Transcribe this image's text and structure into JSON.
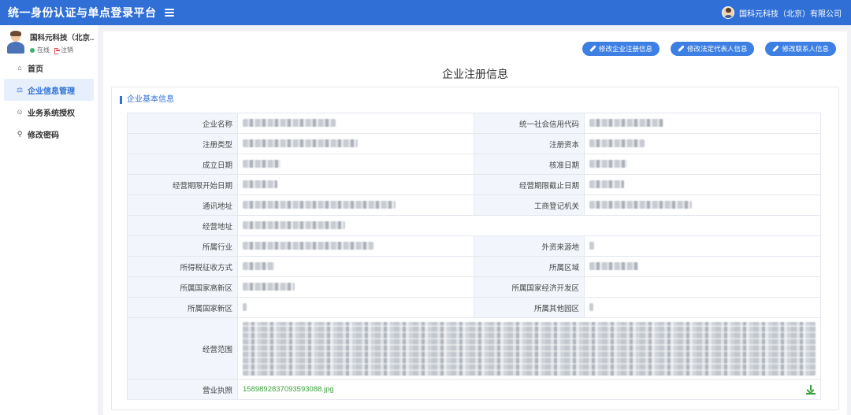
{
  "header": {
    "title": "统一身份认证与单点登录平台",
    "company": "国科元科技（北京）有限公司"
  },
  "sidebar": {
    "profile": {
      "name": "国科元科技（北京...",
      "status_online": "在线",
      "logout": "注销"
    },
    "items": [
      {
        "label": "首页",
        "icon": "home-icon"
      },
      {
        "label": "企业信息管理",
        "icon": "bank-icon"
      },
      {
        "label": "业务系统授权",
        "icon": "users-icon"
      },
      {
        "label": "修改密码",
        "icon": "key-icon"
      }
    ]
  },
  "actions": {
    "edit_registration": "修改企业注册信息",
    "edit_legal_rep": "修改法定代表人信息",
    "edit_contact": "修改联系人信息"
  },
  "page_title": "企业注册信息",
  "section_title": "企业基本信息",
  "fields": {
    "company_name": "企业名称",
    "credit_code": "统一社会信用代码",
    "reg_type": "注册类型",
    "reg_capital": "注册资本",
    "est_date": "成立日期",
    "approval_date": "核准日期",
    "op_start": "经营期限开始日期",
    "op_end": "经营期限截止日期",
    "mail_addr": "通讯地址",
    "reg_authority": "工商登记机关",
    "op_addr": "经营地址",
    "industry": "所属行业",
    "foreign_source": "外资来源地",
    "tax_method": "所得税征收方式",
    "region": "所属区域",
    "high_tech_zone": "所属国家高新区",
    "econ_dev_zone": "所属国家经济开发区",
    "new_area": "所属国家新区",
    "other_park": "所属其他园区",
    "business_scope": "经营范围",
    "license": "营业执照"
  },
  "license_file": "1589892837093593088.jpg"
}
